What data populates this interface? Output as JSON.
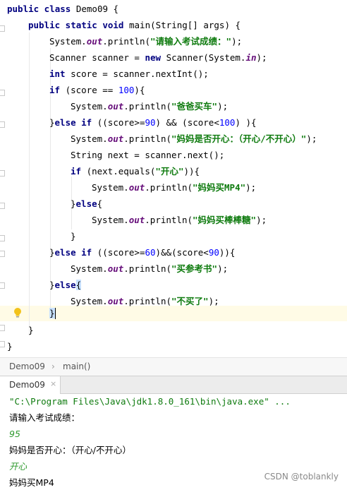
{
  "editor": {
    "l1": {
      "a": "public class ",
      "b": "Demo09 {"
    },
    "l2": {
      "a": "public static void ",
      "b": "main(String[] args) {"
    },
    "l3": {
      "a": "System.",
      "f": "out",
      "b": ".println(",
      "s": "\"请输入考试成绩：\"",
      "c": ");"
    },
    "l4": {
      "a": "Scanner scanner = ",
      "k": "new ",
      "b": "Scanner(System.",
      "f": "in",
      "c": ");"
    },
    "l5": {
      "k": "int ",
      "b": "score = scanner.nextInt();"
    },
    "l6": {
      "k": "if ",
      "b": "(score == ",
      "n": "100",
      "c": "){"
    },
    "l7": {
      "a": "System.",
      "f": "out",
      "b": ".println(",
      "s": "\"爸爸买车\"",
      "c": ");"
    },
    "l8": {
      "a": "}",
      "k": "else if ",
      "b": "((score>=",
      "n1": "90",
      "c": ") && (score<",
      "n2": "100",
      "d": ") ){"
    },
    "l9": {
      "a": "System.",
      "f": "out",
      "b": ".println(",
      "s": "\"妈妈是否开心：（开心/不开心）\"",
      "c": ");"
    },
    "l10": {
      "a": "String next = scanner.next();"
    },
    "l11": {
      "k": "if ",
      "b": "(next.equals(",
      "s": "\"开心\"",
      "c": ")){"
    },
    "l12": {
      "a": "System.",
      "f": "out",
      "b": ".println(",
      "s": "\"妈妈买MP4\"",
      "c": ");"
    },
    "l13": {
      "a": "}",
      "k": "else",
      "c": "{"
    },
    "l14": {
      "a": "System.",
      "f": "out",
      "b": ".println(",
      "s": "\"妈妈买棒棒糖\"",
      "c": ");"
    },
    "l15": {
      "a": "}"
    },
    "l16": {
      "a": "}",
      "k": "else if ",
      "b": "((score>=",
      "n1": "60",
      "c": ")&&(score<",
      "n2": "90",
      "d": ")){"
    },
    "l17": {
      "a": "System.",
      "f": "out",
      "b": ".println(",
      "s": "\"买参考书\"",
      "c": ");"
    },
    "l18": {
      "a": "}",
      "k": "else",
      "c": "{"
    },
    "l19": {
      "a": "System.",
      "f": "out",
      "b": ".println(",
      "s": "\"不买了\"",
      "c": ");"
    },
    "l20": {
      "a": "}"
    },
    "l21": {
      "a": "}"
    },
    "l22": {
      "a": "}"
    }
  },
  "breadcrumb": {
    "class": "Demo09",
    "sep": "›",
    "method": "main()"
  },
  "run_tab": {
    "label": "Demo09",
    "close": "×"
  },
  "console": {
    "cmd": "\"C:\\Program Files\\Java\\jdk1.8.0_161\\bin\\java.exe\" ...",
    "o1": "请输入考试成绩：",
    "i1": "95",
    "o2": "妈妈是否开心：（开心/不开心）",
    "i2": "开心",
    "o3": "妈妈买MP4"
  },
  "watermark": "CSDN @toblankly",
  "colors": {
    "keyword": "#000080",
    "string": "#0f7b0f",
    "number": "#0000ff",
    "field": "#660e7a",
    "current_line": "#fffbe6"
  }
}
